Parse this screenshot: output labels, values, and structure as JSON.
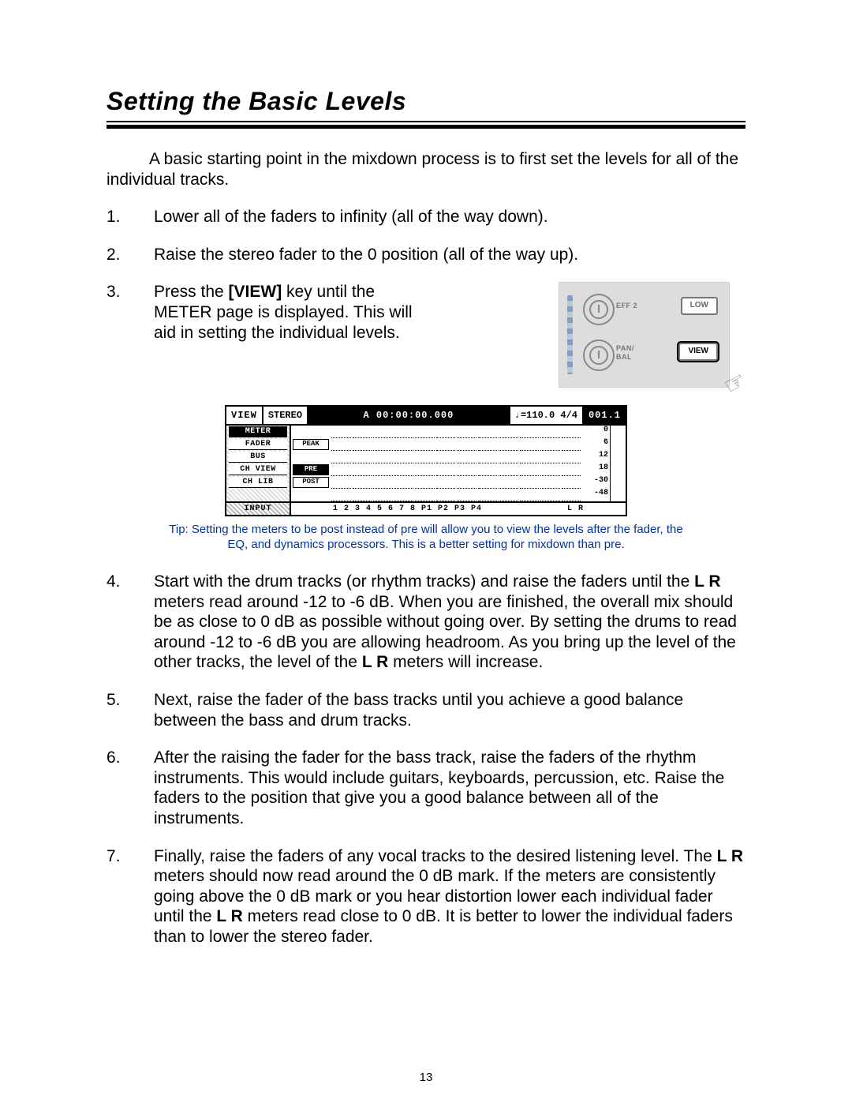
{
  "title": "Setting the Basic Levels",
  "intro": "A basic starting point in the mixdown process is to first set the levels for all of the individual tracks.",
  "steps": {
    "s1": "Lower all of the faders to infinity (all of the way down).",
    "s2": "Raise the stereo fader to the 0 position (all of the way up).",
    "s3_a": "Press the ",
    "s3_key": "[VIEW]",
    "s3_b": " key until the METER page is displayed.  This will aid in setting the individual levels.",
    "s4_a": "Start with the drum tracks (or rhythm tracks) and raise the faders until the ",
    "s4_lr1": "L R",
    "s4_b": " meters read around -12 to -6 dB.  When you are finished, the overall mix should be as close to 0 dB as possible without going over.  By setting the drums to read around -12 to -6 dB you are allowing headroom.  As you bring up the level of the other tracks, the level of the ",
    "s4_lr2": "L R",
    "s4_c": " meters will increase.",
    "s5": "Next, raise the fader of the bass tracks until you achieve a good balance between the bass and drum tracks.",
    "s6": "After the raising the fader for the bass track, raise the faders of the rhythm instruments.  This would include guitars, keyboards, percussion, etc.  Raise the faders to the position that give you a good balance between all of the instruments.",
    "s7_a": "Finally, raise the faders of any vocal tracks to the desired listening level.  The ",
    "s7_lr1": "L R",
    "s7_b": " meters should now read around the 0 dB mark.  If the meters are consistently going above the 0 dB mark or you hear distortion lower each individual fader until the ",
    "s7_lr2": "L R",
    "s7_c": " meters read close to 0 dB.  It is better to lower the individual faders than to lower the stereo fader."
  },
  "panel": {
    "eff2": "EFF 2",
    "low": "LOW",
    "panbal": "PAN/\nBAL",
    "view": "VIEW"
  },
  "meter": {
    "view": "VIEW",
    "stereo": "STEREO",
    "tc": "A  00:00:00.000",
    "tempo": "♩=110.0 4/4",
    "end": "001.1",
    "tabs": [
      "METER",
      "FADER",
      "BUS",
      "CH VIEW",
      "CH LIB"
    ],
    "side": {
      "peak": "PEAK",
      "pre": "PRE",
      "post": "POST"
    },
    "scale": [
      "0",
      "6",
      "12",
      "18",
      "-30",
      "-48"
    ],
    "input_label": "INPUT",
    "inputs": "1  2  3  4  5  6  7  8   P1   P2   P3   P4",
    "lr": "L R"
  },
  "tip": "Tip:  Setting the meters to be post instead of pre will allow you to view the levels after the fader, the EQ, and dynamics processors.  This is a better setting for mixdown than pre.",
  "page_number": "13"
}
